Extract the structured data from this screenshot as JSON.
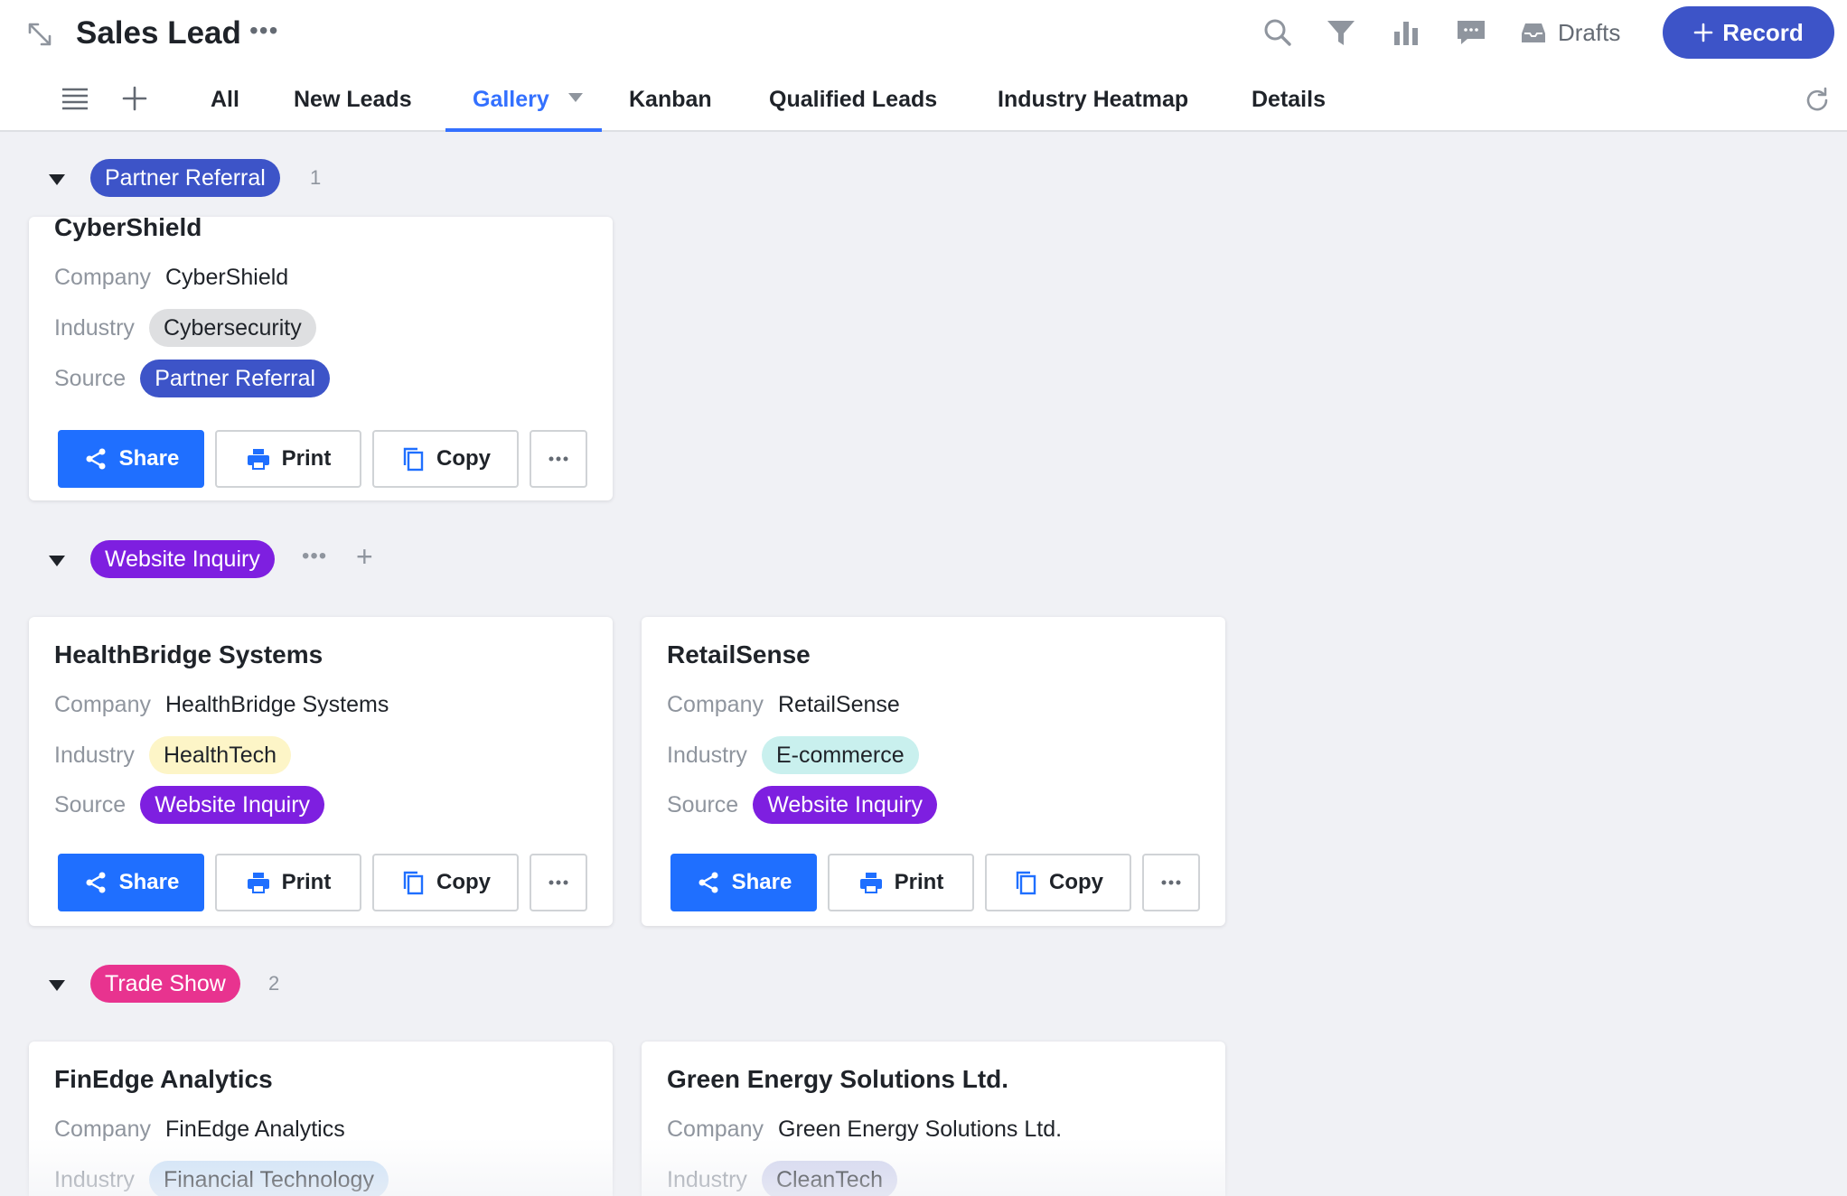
{
  "header": {
    "title": "Sales Lead",
    "drafts_label": "Drafts",
    "record_label": "Record",
    "icons": [
      "expand-icon",
      "search-icon",
      "filter-icon",
      "chart-icon",
      "comment-icon",
      "inbox-icon",
      "refresh-icon"
    ]
  },
  "tabs": [
    {
      "label": "All"
    },
    {
      "label": "New Leads"
    },
    {
      "label": "Gallery",
      "active": true
    },
    {
      "label": "Kanban"
    },
    {
      "label": "Qualified Leads"
    },
    {
      "label": "Industry Heatmap"
    },
    {
      "label": "Details"
    }
  ],
  "labels": {
    "company": "Company",
    "industry": "Industry",
    "source": "Source",
    "share": "Share",
    "print": "Print",
    "copy": "Copy"
  },
  "colors": {
    "accent": "#3370ff",
    "primary_button": "#1f6fff",
    "record_button": "#3d54c8",
    "partner_referral": "#3d54c8",
    "website_inquiry": "#7e1fe0",
    "trade_show": "#e8338f"
  },
  "groups": [
    {
      "name": "Partner Referral",
      "count": "1",
      "cards": [
        {
          "title": "CyberShield",
          "company": "CyberShield",
          "industry": "Cybersecurity",
          "industry_color": "#dedfe1",
          "source": "Partner Referral"
        }
      ]
    },
    {
      "name": "Website Inquiry",
      "cards": [
        {
          "title": "HealthBridge Systems",
          "company": "HealthBridge Systems",
          "industry": "HealthTech",
          "industry_color": "#fdf5c7",
          "source": "Website Inquiry"
        },
        {
          "title": "RetailSense",
          "company": "RetailSense",
          "industry": "E-commerce",
          "industry_color": "#c9f0ee",
          "source": "Website Inquiry"
        }
      ]
    },
    {
      "name": "Trade Show",
      "count": "2",
      "cards": [
        {
          "title": "FinEdge Analytics",
          "company": "FinEdge Analytics",
          "industry": "Financial Technology",
          "industry_color": "#cfe3f8"
        },
        {
          "title": "Green Energy Solutions Ltd.",
          "company": "Green Energy Solutions Ltd.",
          "industry": "CleanTech",
          "industry_color": "#d3d6ef"
        }
      ]
    }
  ]
}
